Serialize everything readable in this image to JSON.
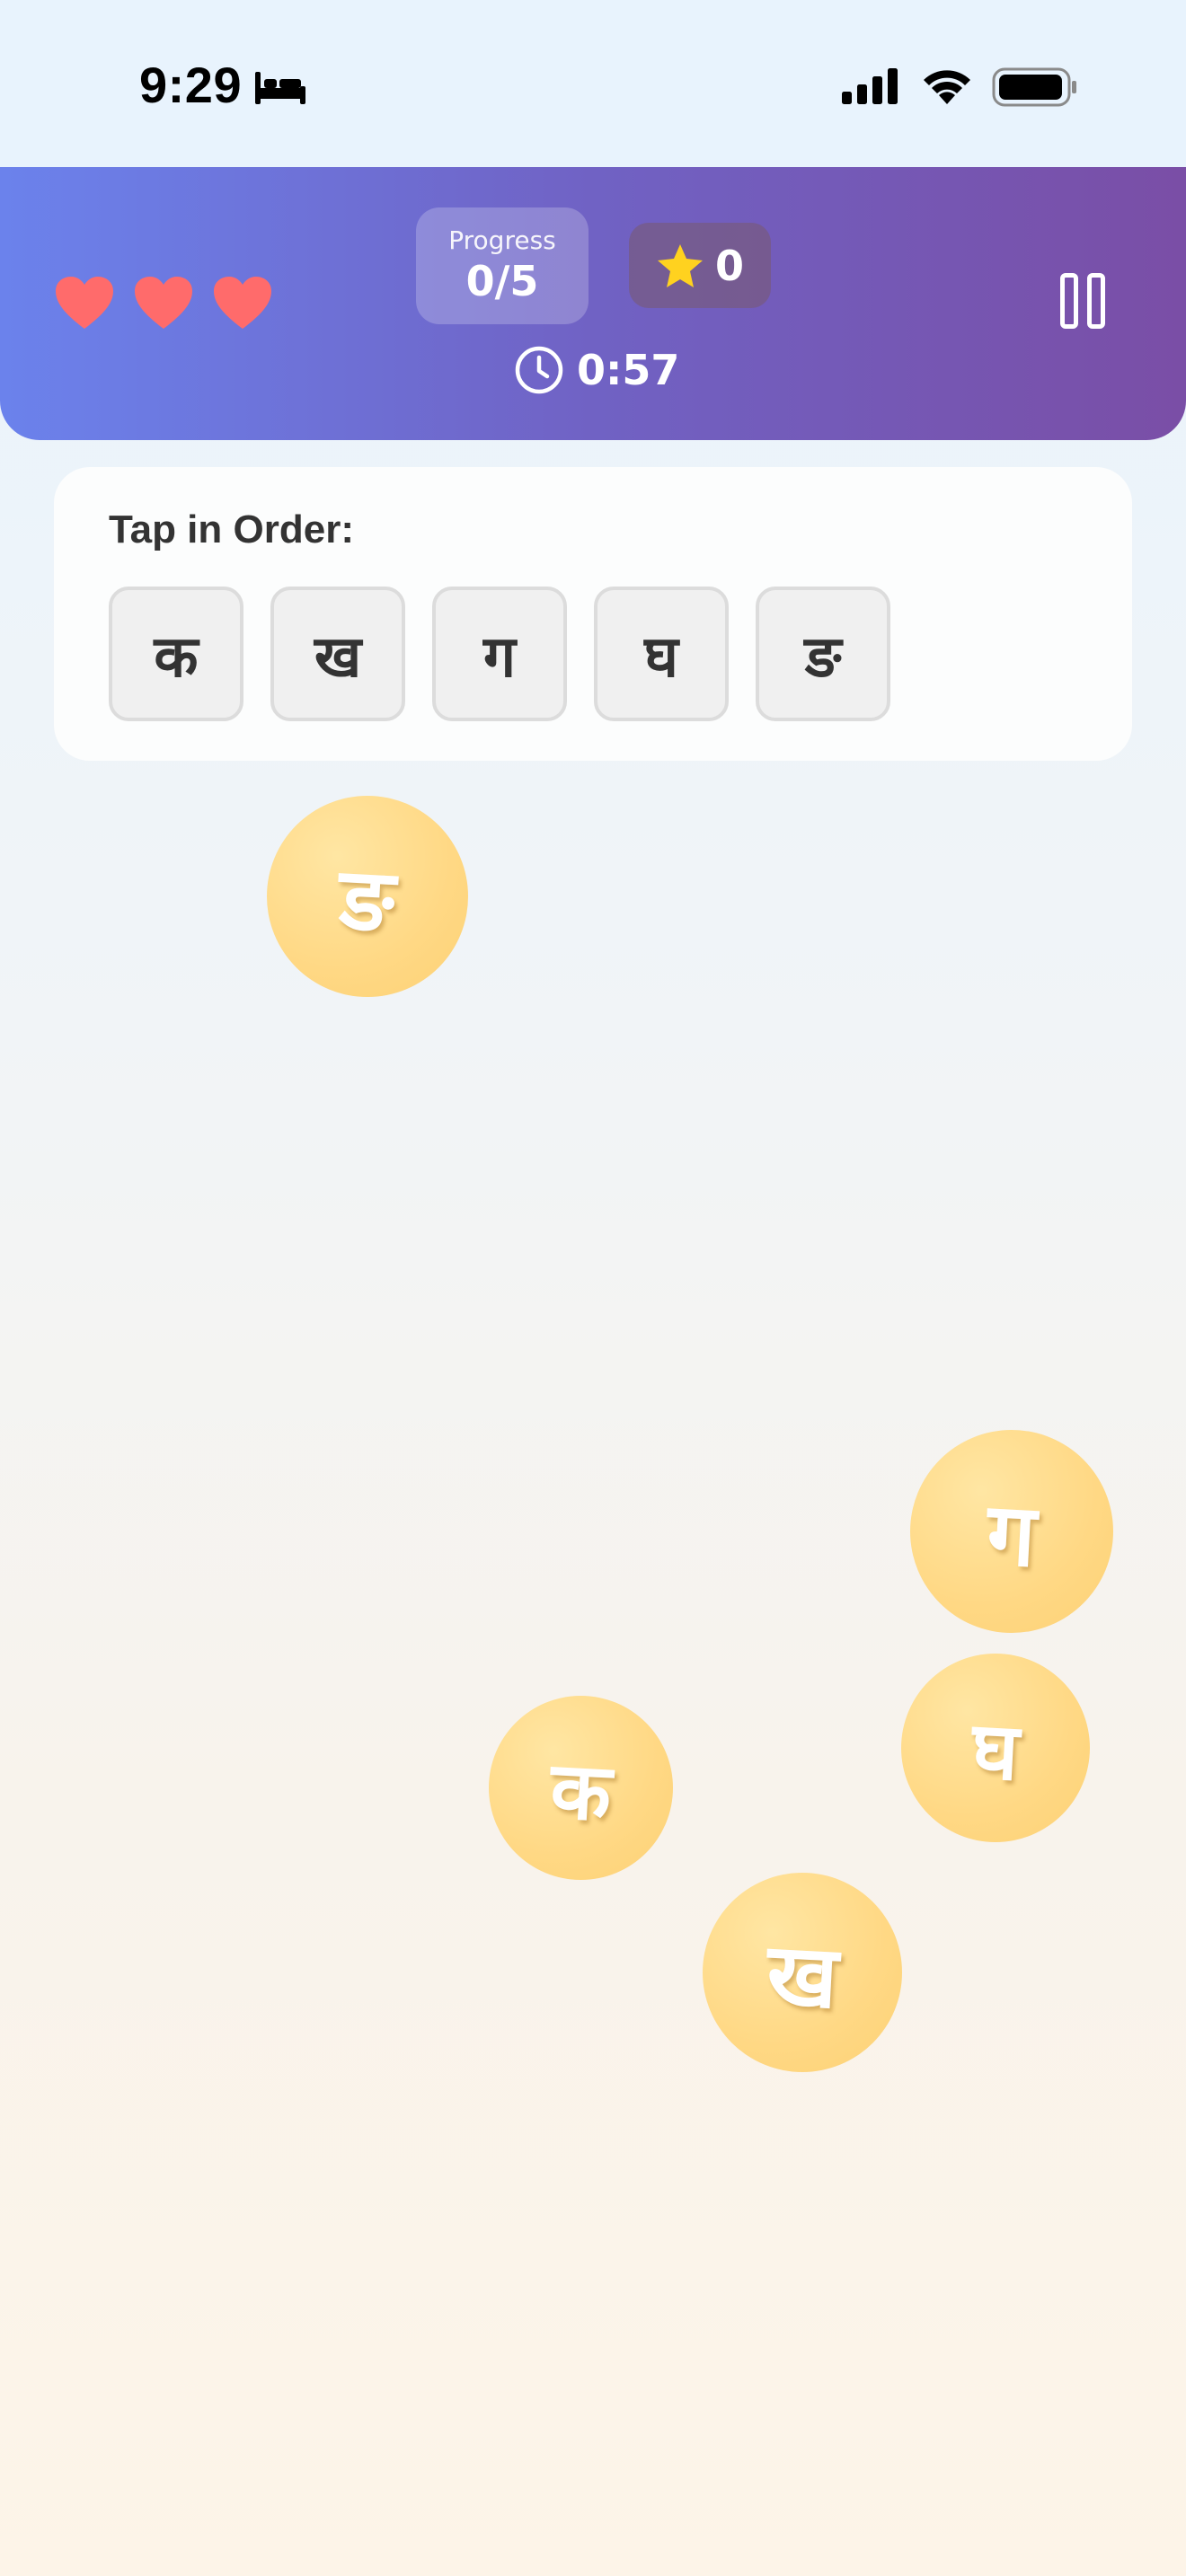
{
  "status_bar": {
    "time": "9:29",
    "icons": [
      "bed-icon",
      "cellular-signal-icon",
      "wifi-icon",
      "battery-icon"
    ]
  },
  "header": {
    "lives": 3,
    "heart_color": "#ff6b6b",
    "progress_label": "Progress",
    "progress_value": "0/5",
    "stars_count": "0",
    "star_color": "#ffd21f",
    "timer": "0:57",
    "gradient": [
      "#6b82ec",
      "#7a4ea6"
    ]
  },
  "order_card": {
    "title": "Tap in Order:",
    "letters": [
      "क",
      "ख",
      "ग",
      "घ",
      "ङ"
    ]
  },
  "bubbles": [
    {
      "letter": "ङ"
    },
    {
      "letter": "ग"
    },
    {
      "letter": "घ"
    },
    {
      "letter": "क"
    },
    {
      "letter": "ख"
    }
  ]
}
